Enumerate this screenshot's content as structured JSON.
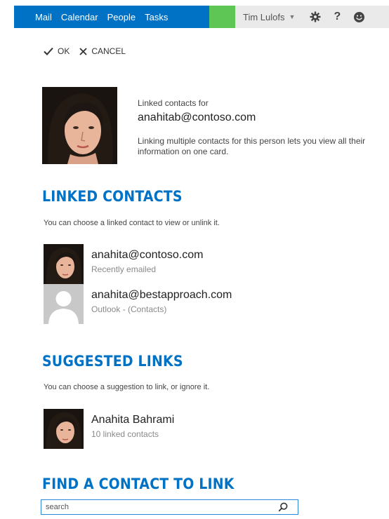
{
  "nav": {
    "items": [
      {
        "label": "Mail"
      },
      {
        "label": "Calendar"
      },
      {
        "label": "People"
      },
      {
        "label": "Tasks"
      }
    ],
    "active": "People",
    "user_name": "Tim Lulofs",
    "icons": [
      "settings-gear-icon",
      "help-icon",
      "smiley-icon"
    ],
    "help_label": "?"
  },
  "commands": {
    "ok_label": "OK",
    "cancel_label": "CANCEL"
  },
  "header": {
    "linked_for_label": "Linked contacts for",
    "email": "anahitab@contoso.com",
    "description": "Linking multiple contacts for this person lets you view all their information on one card."
  },
  "linked_contacts": {
    "title": "LINKED CONTACTS",
    "hint": "You can choose a linked contact to view or unlink it.",
    "items": [
      {
        "name": "anahita@contoso.com",
        "sub": "Recently emailed",
        "avatar": "photo"
      },
      {
        "name": "anahita@bestapproach.com",
        "sub": "Outlook - (Contacts)",
        "avatar": "placeholder"
      }
    ]
  },
  "suggested_links": {
    "title": "SUGGESTED LINKS",
    "hint": "You can choose a suggestion to link, or ignore it.",
    "items": [
      {
        "name": "Anahita Bahrami",
        "sub": "10 linked contacts",
        "avatar": "photo"
      }
    ]
  },
  "find_contact": {
    "title": "FIND A CONTACT TO LINK",
    "search_placeholder": "search"
  },
  "colors": {
    "nav_blue": "#0072c6",
    "accent_green": "#5dc654",
    "title_blue": "#0072c6"
  }
}
